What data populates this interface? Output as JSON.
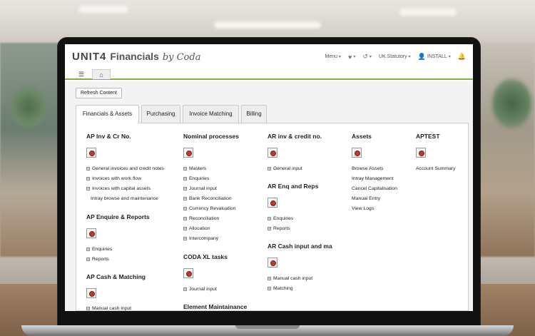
{
  "app": {
    "logo_unit": "UNIT4",
    "logo_product": "Financials",
    "logo_by": "by Coda"
  },
  "nav": {
    "menu": "Menu",
    "company": "UK.Statutory",
    "user": "INSTALL"
  },
  "toolbar": {
    "refresh": "Refresh Content"
  },
  "tabs": [
    {
      "label": "Financials & Assets",
      "active": true
    },
    {
      "label": "Purchasing",
      "active": false
    },
    {
      "label": "Invoice Matching",
      "active": false
    },
    {
      "label": "Billing",
      "active": false
    }
  ],
  "columns": {
    "ap": {
      "sec1": {
        "title": "AP Inv & Cr No.",
        "items": [
          "General invoices and credit notes",
          "Invoices with work flow",
          "Invoices with capital assets",
          "Intray browse and maintenance"
        ]
      },
      "sec2": {
        "title": "AP Enquire & Reports",
        "items": [
          "Enquiries",
          "Reports"
        ]
      },
      "sec3": {
        "title": "AP Cash & Matching",
        "items": [
          "Manual cash input"
        ]
      }
    },
    "nominal": {
      "sec1": {
        "title": "Nominal processes",
        "items": [
          "Masters",
          "Enquiries",
          "Journal input",
          "Bank Reconciliation",
          "Currency Revaluation",
          "Reconciliation",
          "Allocation",
          "Intercompany"
        ]
      },
      "sec2": {
        "title": "CODA XL tasks",
        "items": [
          "Journal input"
        ]
      },
      "sec3": {
        "title": "Element Maintainance"
      }
    },
    "ar": {
      "sec1": {
        "title": "AR inv & credit no.",
        "items": [
          "General input"
        ]
      },
      "sec2": {
        "title": "AR Enq and Reps",
        "items": [
          "Enquiries",
          "Reports"
        ]
      },
      "sec3": {
        "title": "AR Cash input and ma",
        "items": [
          "Manual cash input",
          "Matching"
        ]
      }
    },
    "assets": {
      "title": "Assets",
      "items": [
        "Browse Assets",
        "Intray Management",
        "Cancel Capitalisation",
        "Manual Entry",
        "View Logs"
      ]
    },
    "aptest": {
      "title": "APTEST",
      "items": [
        "Account Summary"
      ]
    }
  }
}
